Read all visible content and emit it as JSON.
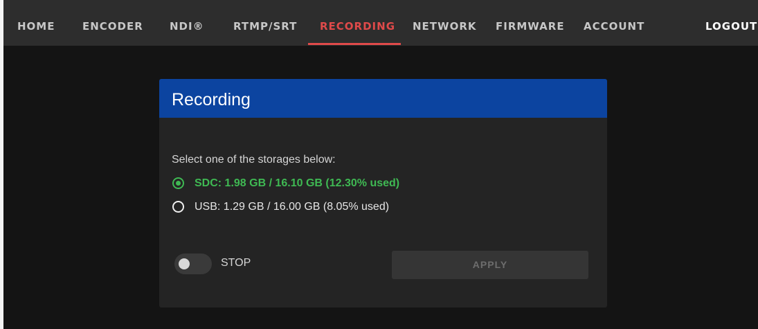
{
  "nav": {
    "items": [
      {
        "label": "HOME"
      },
      {
        "label": "ENCODER"
      },
      {
        "label": "NDI®"
      },
      {
        "label": "RTMP/SRT"
      },
      {
        "label": "RECORDING",
        "active": true
      },
      {
        "label": "NETWORK"
      },
      {
        "label": "FIRMWARE"
      },
      {
        "label": "ACCOUNT"
      }
    ],
    "logout": "LOGOUT"
  },
  "card": {
    "title": "Recording",
    "prompt": "Select one of the storages below:",
    "storages": [
      {
        "label": "SDC: 1.98 GB / 16.10 GB (12.30% used)",
        "selected": true
      },
      {
        "label": "USB: 1.29 GB / 16.00 GB (8.05% used)",
        "selected": false
      }
    ],
    "toggle": {
      "label": "STOP",
      "on": false
    },
    "apply_label": "APPLY"
  },
  "colors": {
    "accent_active_tab": "#e04a4a",
    "header_blue": "#0c44a0",
    "selected_green": "#3fb953"
  }
}
